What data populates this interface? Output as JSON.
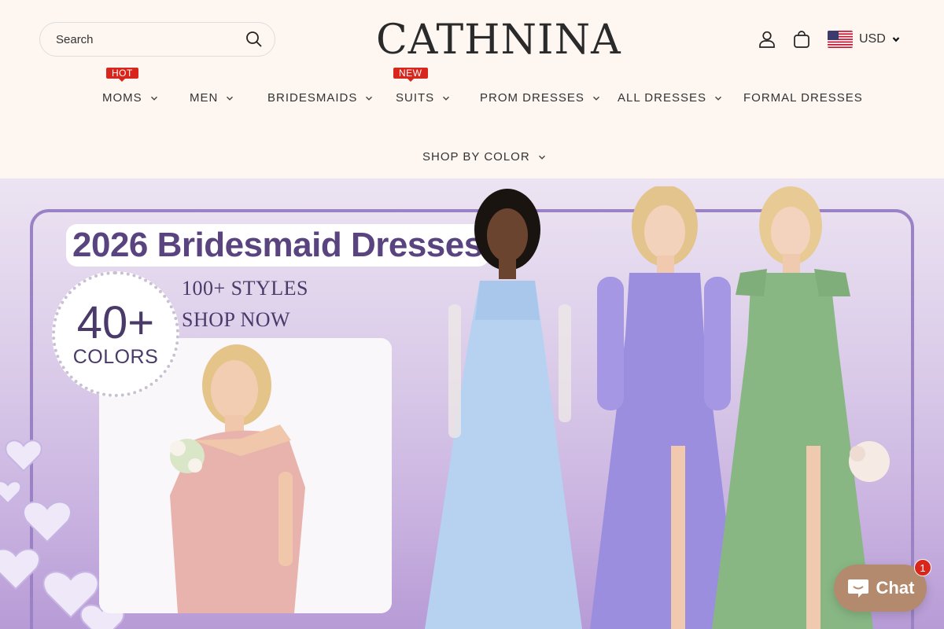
{
  "search": {
    "placeholder": "Search"
  },
  "brand": {
    "name": "CATHNINA"
  },
  "currency": {
    "code": "USD"
  },
  "nav": {
    "items": [
      {
        "label": "MOMS",
        "badge": "HOT"
      },
      {
        "label": "MEN"
      },
      {
        "label": "BRIDESMAIDS"
      },
      {
        "label": "SUITS",
        "badge": "NEW"
      },
      {
        "label": "PROM DRESSES"
      },
      {
        "label": "ALL DRESSES"
      },
      {
        "label": "FORMAL DRESSES"
      },
      {
        "label": "SHOP BY COLOR"
      }
    ]
  },
  "hero": {
    "title": "2026 Bridesmaid Dresses",
    "badge_number": "40+",
    "badge_label": "COLORS",
    "tagline_1": "100+ STYLES",
    "tagline_2": "SHOP NOW"
  },
  "chat": {
    "label": "Chat",
    "unread": "1"
  },
  "colors": {
    "badge_red": "#d9261c",
    "header_bg": "#fdf6f1",
    "chat_bg": "#b38a6e",
    "hero_purple": "#5a4480"
  },
  "icons": [
    "search-icon",
    "account-icon",
    "cart-icon",
    "us-flag-icon",
    "chevron-down-icon",
    "chat-icon"
  ]
}
